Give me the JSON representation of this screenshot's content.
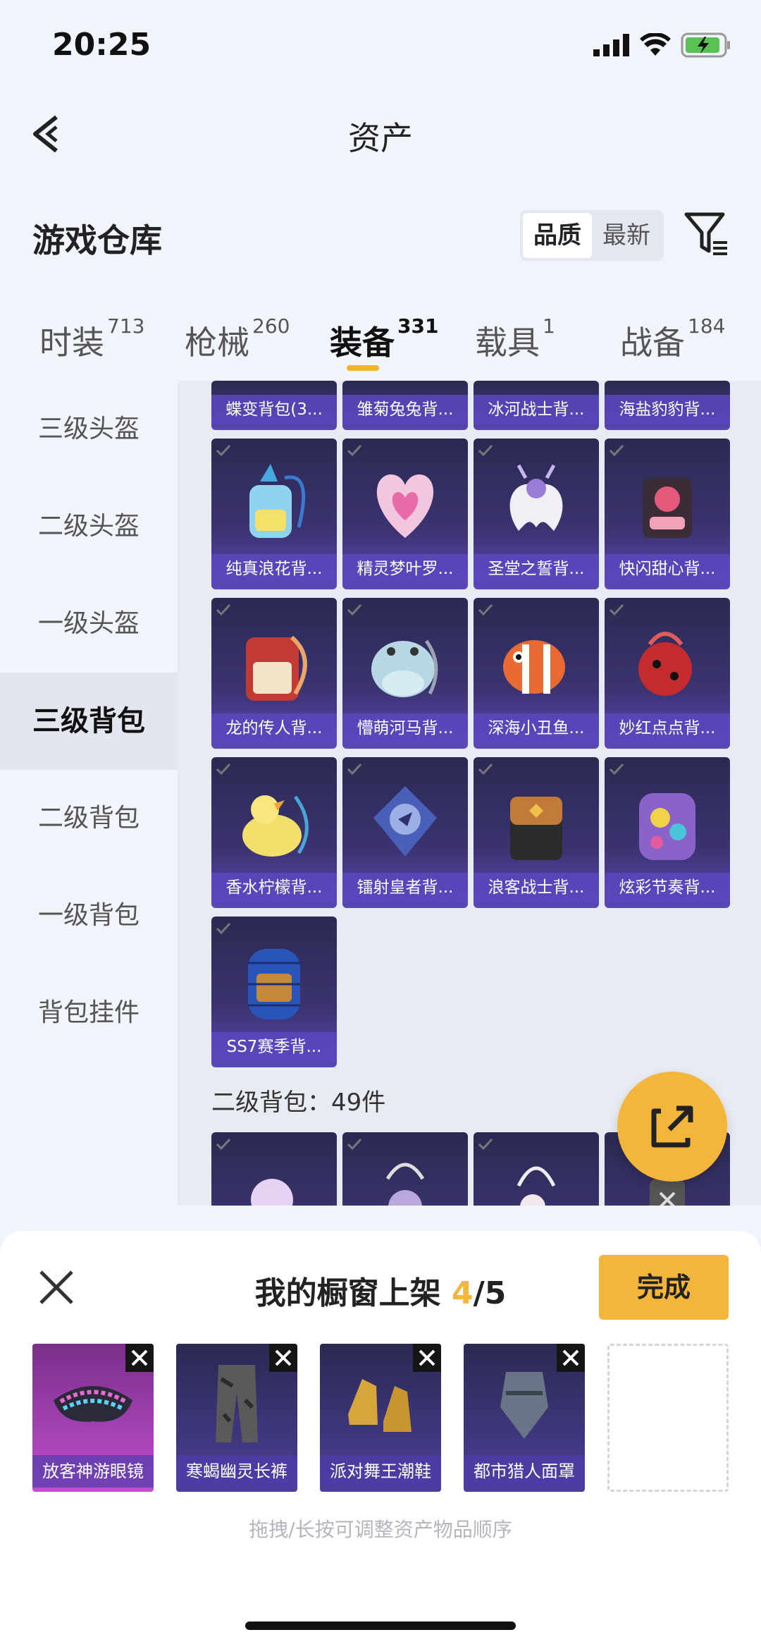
{
  "status_bar": {
    "time": "20:25"
  },
  "header": {
    "title": "资产"
  },
  "section": {
    "title": "游戏仓库"
  },
  "sort": {
    "options": [
      "品质",
      "最新"
    ],
    "active": "品质"
  },
  "tabs": [
    {
      "label": "时装",
      "count": "713"
    },
    {
      "label": "枪械",
      "count": "260"
    },
    {
      "label": "装备",
      "count": "331"
    },
    {
      "label": "载具",
      "count": "1"
    },
    {
      "label": "战备",
      "count": "184"
    }
  ],
  "active_tab": "装备",
  "sidenav": [
    {
      "label": "三级头盔"
    },
    {
      "label": "二级头盔"
    },
    {
      "label": "一级头盔"
    },
    {
      "label": "三级背包"
    },
    {
      "label": "二级背包"
    },
    {
      "label": "一级背包"
    },
    {
      "label": "背包挂件"
    }
  ],
  "active_nav": "三级背包",
  "grid": {
    "top_row": [
      "蝶变背包(3...",
      "雏菊兔兔背...",
      "冰河战士背...",
      "海盐豹豹背..."
    ],
    "rows": [
      [
        "纯真浪花背...",
        "精灵梦叶罗...",
        "圣堂之誓背...",
        "快闪甜心背..."
      ],
      [
        "龙的传人背...",
        "懵萌河马背...",
        "深海小丑鱼...",
        "妙红点点背..."
      ],
      [
        "香水柠檬背...",
        "镭射皇者背...",
        "浪客战士背...",
        "炫彩节奏背..."
      ],
      [
        "SS7赛季背..."
      ]
    ],
    "next_section_label": "二级背包：49件"
  },
  "sheet": {
    "title_prefix": "我的橱窗上架 ",
    "count": "4",
    "total": "/5",
    "done_label": "完成",
    "slots": [
      {
        "label": "放客神游眼镜",
        "color": "#b14fbf"
      },
      {
        "label": "寒蝎幽灵长裤",
        "color": "#3b3370"
      },
      {
        "label": "派对舞王潮鞋",
        "color": "#3b3370"
      },
      {
        "label": "都市猎人面罩",
        "color": "#3b3370"
      }
    ],
    "hint": "拖拽/长按可调整资产物品顺序"
  },
  "colors": {
    "accent": "#f3b53a",
    "card_purple": "#5a48b6"
  }
}
